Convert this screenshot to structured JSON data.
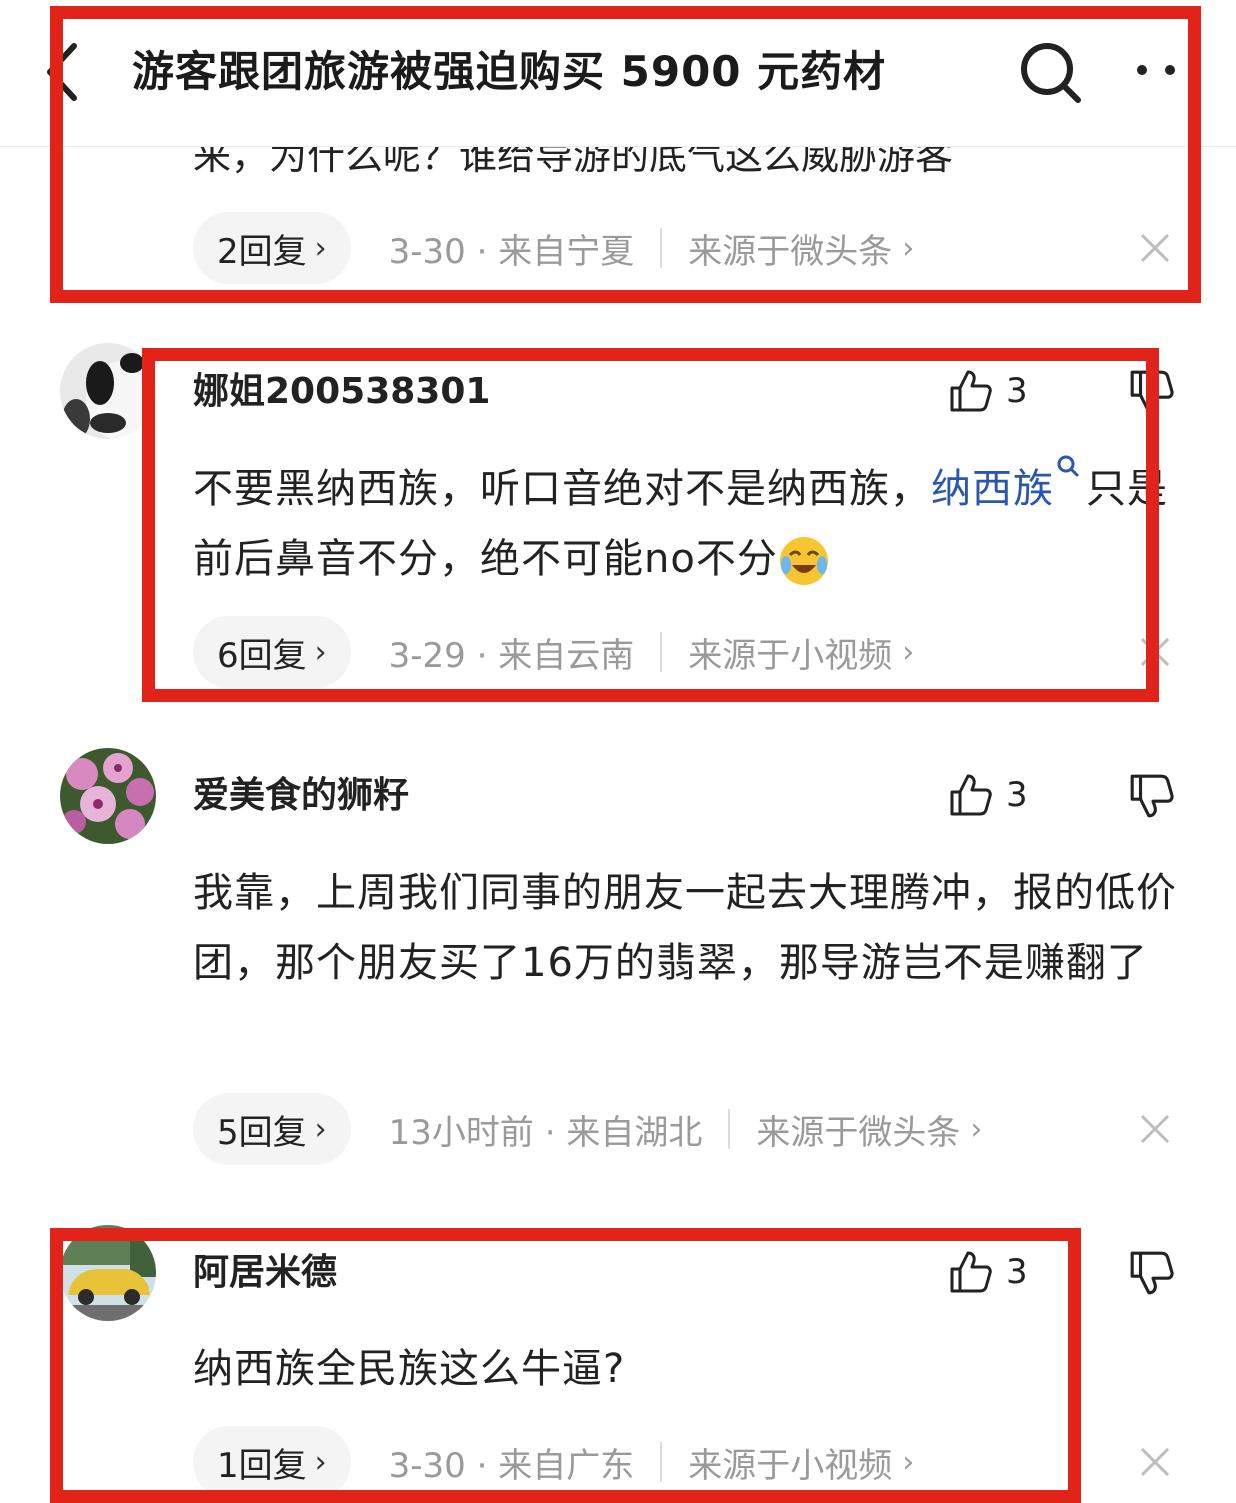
{
  "header": {
    "title": "游客跟团旅游被强迫购买 5900 元药材"
  },
  "colors": {
    "annotation_red": "#e2231a",
    "mention_blue": "#2a55b0",
    "meta_gray": "#9a9a9a"
  },
  "comments": [
    {
      "text_partial": "来，为什么呢？谁给导游的底气这么威胁游客",
      "replies": "2回复",
      "info": "3-30 · 来自宁夏",
      "source": "来源于微头条"
    },
    {
      "username": "娜姐200538301",
      "likes": "3",
      "text_a": "不要黑纳西族，听口音绝对不是纳西族，",
      "mention": "纳西族",
      "text_b": "只是前后鼻音不分，绝不可能no不分",
      "replies": "6回复",
      "info": "3-29 · 来自云南",
      "source": "来源于小视频"
    },
    {
      "username": "爱美食的狮籽",
      "likes": "3",
      "text": "我靠，上周我们同事的朋友一起去大理腾冲，报的低价团，那个朋友买了16万的翡翠，那导游岂不是赚翻了",
      "replies": "5回复",
      "info": "13小时前 · 来自湖北",
      "source": "来源于微头条"
    },
    {
      "username": "阿居米德",
      "likes": "3",
      "text": "纳西族全民族这么牛逼?",
      "replies": "1回复",
      "info": "3-30 · 来自广东",
      "source": "来源于小视频"
    }
  ]
}
